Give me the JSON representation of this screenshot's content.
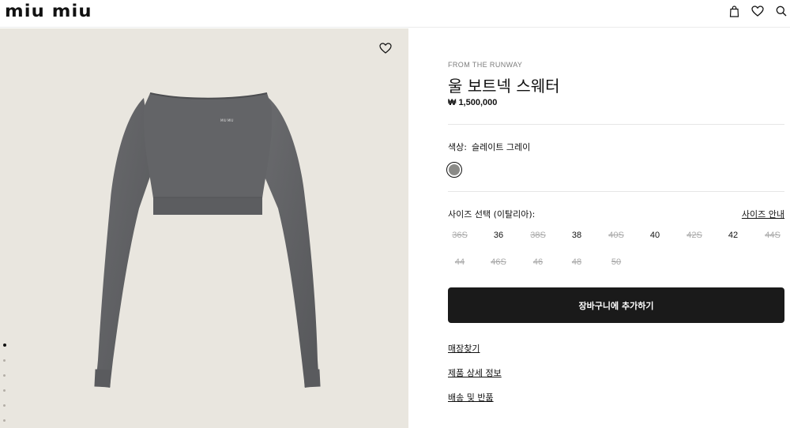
{
  "header": {
    "logo": "miu miu",
    "icons": [
      "bag-icon",
      "heart-icon",
      "search-icon"
    ]
  },
  "gallery": {
    "image": "gray-boatneck-crop-sweater",
    "image_logo_text": "MIU MIU",
    "dot_count": 6,
    "active_dot": 0
  },
  "product": {
    "eyebrow": "FROM THE RUNWAY",
    "title": "울 보트넥 스웨터",
    "price": "₩ 1,500,000",
    "color_label": "색상:",
    "color_value": "슬레이트 그레이",
    "swatch_color": "#8b8b88",
    "size_label": "사이즈 선택 (이탈리아):",
    "size_guide": "사이즈 안내",
    "sizes": [
      {
        "label": "36S",
        "available": false
      },
      {
        "label": "36",
        "available": true
      },
      {
        "label": "38S",
        "available": false
      },
      {
        "label": "38",
        "available": true
      },
      {
        "label": "40S",
        "available": false
      },
      {
        "label": "40",
        "available": true
      },
      {
        "label": "42S",
        "available": false
      },
      {
        "label": "42",
        "available": true
      },
      {
        "label": "44S",
        "available": false
      },
      {
        "label": "44",
        "available": false
      },
      {
        "label": "46S",
        "available": false
      },
      {
        "label": "46",
        "available": false
      },
      {
        "label": "48",
        "available": false
      },
      {
        "label": "50",
        "available": false
      }
    ],
    "add_to_cart": "장바구니에 추가하기",
    "links": {
      "store": "매장찾기",
      "details": "제품 상세 정보",
      "shipping": "배송 및 반품"
    }
  },
  "colors": {
    "cta_bg": "#1a1a1a",
    "gallery_bg": "#e9e6df",
    "sweater": "#5f6063"
  }
}
